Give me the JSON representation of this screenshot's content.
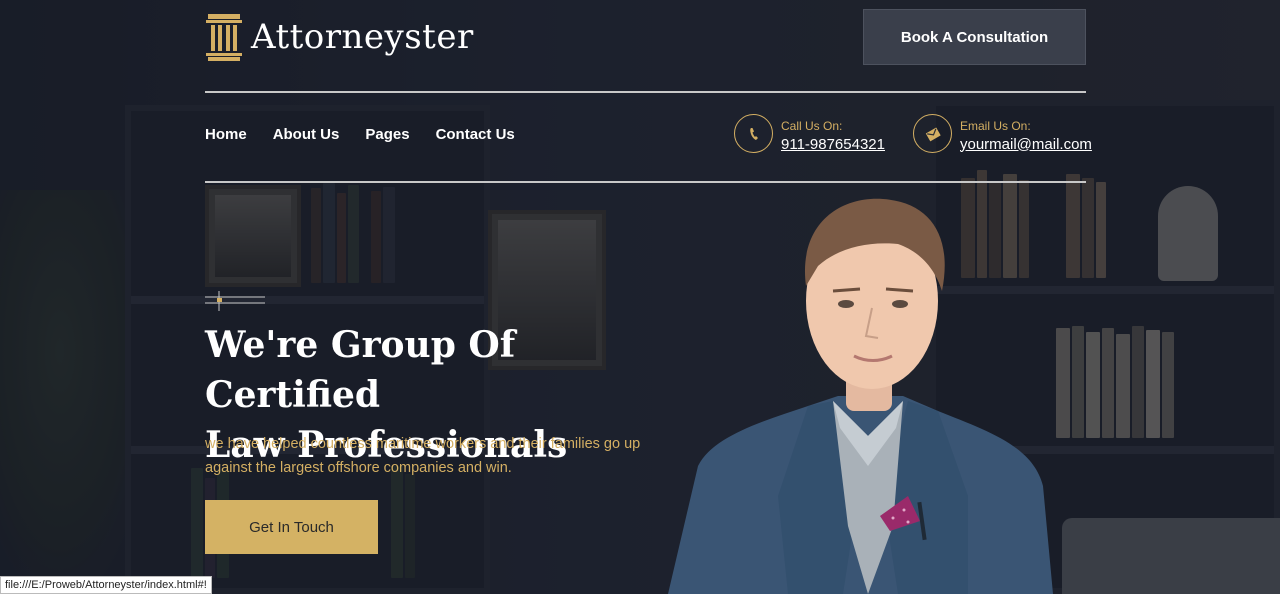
{
  "brand": {
    "name": "Attorneyster"
  },
  "header": {
    "cta_label": "Book A Consultation",
    "nav": [
      {
        "label": "Home"
      },
      {
        "label": "About Us"
      },
      {
        "label": "Pages"
      },
      {
        "label": "Contact Us"
      }
    ],
    "phone": {
      "label": "Call Us On:",
      "value": "911-987654321",
      "icon": "phone-icon"
    },
    "email": {
      "label": "Email Us On:",
      "value": "yourmail@mail.com",
      "icon": "envelope-icon"
    }
  },
  "hero": {
    "title_line1": "We're Group Of Certified",
    "title_line2": "Law Professionals",
    "subtitle": "we have helped countless maritime workers and their families go up against the largest offshore companies and win.",
    "button_label": "Get In Touch"
  },
  "status_bar": {
    "url": "file:///E:/Proweb/Attorneyster/index.html#!"
  },
  "colors": {
    "accent": "#d4af63",
    "background": "#1e2330",
    "button": "#d4b264"
  }
}
